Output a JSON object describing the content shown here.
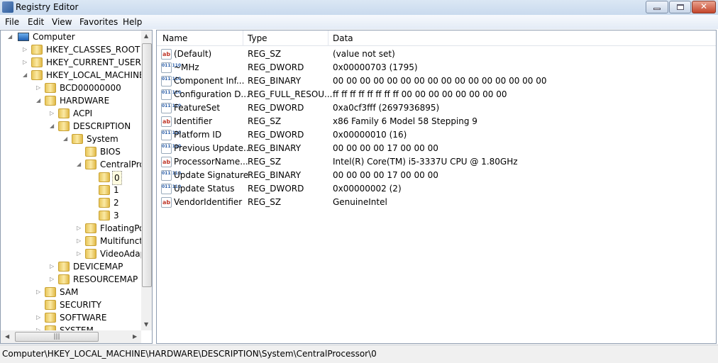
{
  "window": {
    "title": "Registry Editor",
    "close_glyph": "✕"
  },
  "menu": [
    "File",
    "Edit",
    "View",
    "Favorites",
    "Help"
  ],
  "tree": [
    {
      "label": "Computer",
      "level": 0,
      "expander": "expanded",
      "icon": "computer-icon"
    },
    {
      "label": "HKEY_CLASSES_ROOT",
      "level": 1,
      "expander": "collapsed"
    },
    {
      "label": "HKEY_CURRENT_USER",
      "level": 1,
      "expander": "collapsed"
    },
    {
      "label": "HKEY_LOCAL_MACHINE",
      "level": 1,
      "expander": "expanded"
    },
    {
      "label": "BCD00000000",
      "level": 2,
      "expander": "collapsed"
    },
    {
      "label": "HARDWARE",
      "level": 2,
      "expander": "expanded"
    },
    {
      "label": "ACPI",
      "level": 3,
      "expander": "collapsed"
    },
    {
      "label": "DESCRIPTION",
      "level": 3,
      "expander": "expanded"
    },
    {
      "label": "System",
      "level": 4,
      "expander": "expanded"
    },
    {
      "label": "BIOS",
      "level": 5,
      "expander": "none"
    },
    {
      "label": "CentralPro",
      "level": 5,
      "expander": "expanded"
    },
    {
      "label": "0",
      "level": 6,
      "expander": "none",
      "selected": true
    },
    {
      "label": "1",
      "level": 6,
      "expander": "none"
    },
    {
      "label": "2",
      "level": 6,
      "expander": "none"
    },
    {
      "label": "3",
      "level": 6,
      "expander": "none"
    },
    {
      "label": "FloatingPo",
      "level": 5,
      "expander": "collapsed"
    },
    {
      "label": "Multifunct",
      "level": 5,
      "expander": "collapsed"
    },
    {
      "label": "VideoAdap",
      "level": 5,
      "expander": "collapsed"
    },
    {
      "label": "DEVICEMAP",
      "level": 3,
      "expander": "collapsed"
    },
    {
      "label": "RESOURCEMAP",
      "level": 3,
      "expander": "collapsed"
    },
    {
      "label": "SAM",
      "level": 2,
      "expander": "collapsed"
    },
    {
      "label": "SECURITY",
      "level": 2,
      "expander": "none"
    },
    {
      "label": "SOFTWARE",
      "level": 2,
      "expander": "collapsed"
    },
    {
      "label": "SYSTEM",
      "level": 2,
      "expander": "collapsed"
    }
  ],
  "list": {
    "columns": [
      "Name",
      "Type",
      "Data"
    ],
    "rows": [
      {
        "icon": "string",
        "name": "(Default)",
        "type": "REG_SZ",
        "data": "(value not set)"
      },
      {
        "icon": "binary",
        "name": "~MHz",
        "type": "REG_DWORD",
        "data": "0x00000703 (1795)"
      },
      {
        "icon": "binary",
        "name": "Component Inf...",
        "type": "REG_BINARY",
        "data": "00 00 00 00 00 00 00 00 00 00 00 00 00 00 00 00"
      },
      {
        "icon": "binary",
        "name": "Configuration D...",
        "type": "REG_FULL_RESOU...",
        "data": "ff ff ff ff ff ff ff ff 00 00 00 00 00 00 00 00"
      },
      {
        "icon": "binary",
        "name": "FeatureSet",
        "type": "REG_DWORD",
        "data": "0xa0cf3fff (2697936895)"
      },
      {
        "icon": "string",
        "name": "Identifier",
        "type": "REG_SZ",
        "data": "x86 Family 6 Model 58 Stepping 9"
      },
      {
        "icon": "binary",
        "name": "Platform ID",
        "type": "REG_DWORD",
        "data": "0x00000010 (16)"
      },
      {
        "icon": "binary",
        "name": "Previous Update...",
        "type": "REG_BINARY",
        "data": "00 00 00 00 17 00 00 00"
      },
      {
        "icon": "string",
        "name": "ProcessorName...",
        "type": "REG_SZ",
        "data": "Intel(R) Core(TM) i5-3337U CPU @ 1.80GHz"
      },
      {
        "icon": "binary",
        "name": "Update Signature",
        "type": "REG_BINARY",
        "data": "00 00 00 00 17 00 00 00"
      },
      {
        "icon": "binary",
        "name": "Update Status",
        "type": "REG_DWORD",
        "data": "0x00000002 (2)"
      },
      {
        "icon": "string",
        "name": "VendorIdentifier",
        "type": "REG_SZ",
        "data": "GenuineIntel"
      }
    ]
  },
  "icon_text": {
    "string": "ab",
    "binary": "011 110"
  },
  "status": "Computer\\HKEY_LOCAL_MACHINE\\HARDWARE\\DESCRIPTION\\System\\CentralProcessor\\0"
}
